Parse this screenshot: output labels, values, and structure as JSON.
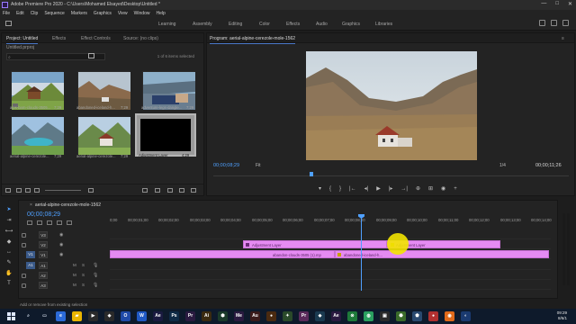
{
  "window": {
    "title": "Adobe Premiere Pro 2020 - C:\\Users\\Mohamed Elsayed\\Desktop\\Untitled *",
    "controls": [
      "—",
      "□",
      "✕"
    ]
  },
  "menu": [
    "File",
    "Edit",
    "Clip",
    "Sequence",
    "Markers",
    "Graphics",
    "View",
    "Window",
    "Help"
  ],
  "workspaces": [
    "Learning",
    "Assembly",
    "Editing",
    "Color",
    "Effects",
    "Audio",
    "Graphics",
    "Libraries"
  ],
  "project_panel": {
    "tabs": [
      "Project: Untitled",
      "Effects",
      "Effect Controls",
      "Source: (no clips)"
    ],
    "path": "Untitled.prproj",
    "search_placeholder": "",
    "items_count": "1 of 6 items selected",
    "items": [
      {
        "name": "alps-barn-clouds-3505...",
        "duration": "7;29"
      },
      {
        "name": "abandoned-iceland-h...",
        "duration": "7;29"
      },
      {
        "name": "adventure-legs-dangle...",
        "duration": "7;29"
      },
      {
        "name": "aerial-alpine-cerezole...",
        "duration": "7;29"
      },
      {
        "name": "aerial-alpine-cerezole...",
        "duration": "7;29"
      },
      {
        "name": "Adjustment Layer",
        "duration": "4;29"
      }
    ]
  },
  "program_monitor": {
    "title": "Program: aerial-alpine-cerezole-mole-1562",
    "timecode_current": "00;00;08;29",
    "fit": "Fit",
    "quality": "1/4",
    "timecode_duration": "00;00;11;26",
    "transport": [
      "▾",
      "{",
      "}",
      "|←",
      "◂|",
      "▶",
      "|▸",
      "→|",
      "⊕",
      "⊞",
      "◉",
      "+"
    ]
  },
  "timeline": {
    "sequence_name": "aerial-alpine-cerezole-mole-1562",
    "timecode": "00;00;08;29",
    "ruler": [
      "0;00",
      "00;00;01;00",
      "00;00;02;00",
      "00;00;03;00",
      "00;00;04;00",
      "00;00;05;00",
      "00;00;06;00",
      "00;00;07;00",
      "00;00;08;00",
      "00;00;09;00",
      "00;00;10;00",
      "00;00;11;00",
      "00;00;12;00",
      "00;00;13;00",
      "00;00;14;00",
      "00;00;15;00"
    ],
    "tracks": [
      {
        "name": "V3"
      },
      {
        "name": "V2",
        "clips": [
          {
            "label": "Adjustment Layer"
          },
          {
            "label": "Adjustment Layer"
          }
        ]
      },
      {
        "name": "V1",
        "source": "V1",
        "clips": [
          {
            "label": "abandon-clouds-3505 (1).mp"
          },
          {
            "label": "abandoned-iceland-h..."
          }
        ]
      },
      {
        "name": "A1",
        "source": "A1"
      },
      {
        "name": "A2"
      },
      {
        "name": "A3"
      }
    ]
  },
  "status": "Add or remove from existing selection",
  "taskbar": {
    "time": "09:29",
    "date": "8/6/1"
  }
}
